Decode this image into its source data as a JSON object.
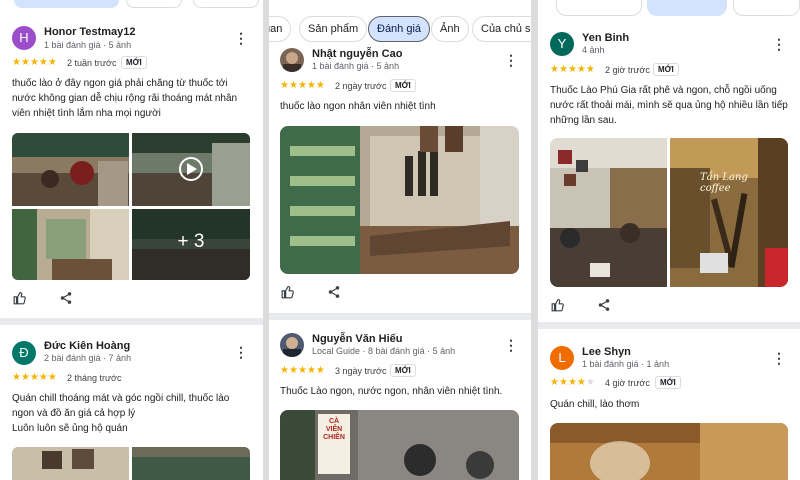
{
  "tabs": {
    "t1": "uan",
    "t2": "Sản phẩm",
    "t3": "Đánh giá",
    "t4": "Ảnh",
    "t5": "Của chủ sở"
  },
  "colors": {
    "star": "#f4b400",
    "accent_chip": "#d3e3fd"
  },
  "reviews": [
    {
      "avatar_letter": "H",
      "avatar_color": "#9c4dcc",
      "name": "Honor Testmay12",
      "meta": "1 bài đánh giá · 5 ảnh",
      "rating": 5,
      "stars": "★★★★★",
      "time": "2 tuần trước",
      "badge": "MỚI",
      "text": "thuốc lào ở đây ngon giá phải chăng từ thuốc tới nước không gian dễ chịu rộng rãi thoáng mát nhân viên nhiệt tình lắm nha mọi người",
      "more_photos": "+ 3",
      "icons": [
        "thumb-up-icon",
        "share-icon",
        "more-vert-icon",
        "play-icon"
      ]
    },
    {
      "avatar_letter": "Đ",
      "avatar_color": "#00796b",
      "name": "Đức Kiên Hoàng",
      "meta": "2 bài đánh giá · 7 ảnh",
      "rating": 5,
      "stars": "★★★★★",
      "time": "2 tháng trước",
      "text_line1": "Quán chill thoáng mát và góc ngồi chill, thuốc lào ngon và đồ ăn giá cả hợp lý",
      "text_line2": "Luôn luôn sẽ ủng hộ quán"
    },
    {
      "name": "Nhật nguyễn Cao",
      "meta": "1 bài đánh giá · 5 ảnh",
      "rating": 5,
      "stars": "★★★★★",
      "time": "2 ngày trước",
      "badge": "MỚI",
      "text": "thuốc lào ngon nhân viên nhiệt tình"
    },
    {
      "name": "Nguyễn Văn Hiếu",
      "meta": "Local Guide · 8 bài đánh giá · 5 ảnh",
      "rating": 5,
      "stars": "★★★★★",
      "time": "3 ngày trước",
      "badge": "MỚI",
      "text": "Thuốc Lào ngon, nước ngon, nhân viên nhiệt tình.",
      "photo_sign": "CÀ VIÊN CHIÊN"
    },
    {
      "avatar_letter": "Y",
      "avatar_color": "#00695c",
      "name": "Yen Binh",
      "meta": "4 ảnh",
      "rating": 5,
      "stars": "★★★★★",
      "time": "2 giờ trước",
      "badge": "MỚI",
      "text": "Thuốc Lào Phú Gia rất phê và ngon, chỗ ngồi uống nước rất thoải mái, mình sẽ qua ủng hộ nhiều lần tiếp những lần sau.",
      "photo_sign": "Tần Lang coffee"
    },
    {
      "avatar_letter": "L",
      "avatar_color": "#ef6c00",
      "name": "Lee Shyn",
      "meta": "1 bài đánh giá · 1 ảnh",
      "rating": 4,
      "stars": "★★★★★",
      "time": "4 giờ trước",
      "badge": "MỚI",
      "text": "Quán chill, lào thơm"
    }
  ]
}
